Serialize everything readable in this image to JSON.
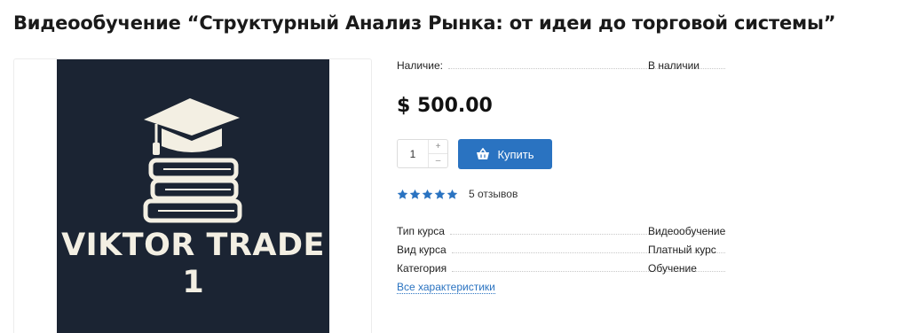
{
  "product": {
    "title": "Видеообучение “Структурный Анализ Рынка: от идеи до торговой системы”",
    "image": {
      "brand_line1": "VIKTOR TRADE",
      "brand_line2": "1",
      "background_color": "#1b2433",
      "foreground_color": "#f3efe3"
    },
    "availability": {
      "label": "Наличие:",
      "value": "В наличии"
    },
    "price": "$ 500.00",
    "quantity": "1",
    "qty_increase": "+",
    "qty_decrease": "–",
    "buy_label": "Купить",
    "buy_icon": "basket-icon",
    "rating": {
      "stars": 5,
      "max": 5,
      "reviews_text": "5 отзывов",
      "star_color": "#2a73c1"
    },
    "specs": [
      {
        "key": "Тип курса",
        "value": "Видеообучение"
      },
      {
        "key": "Вид курса",
        "value": "Платный курс"
      },
      {
        "key": "Категория",
        "value": "Обучение"
      }
    ],
    "all_specs_link": "Все характеристики"
  },
  "colors": {
    "accent": "#2a73c1",
    "text": "#222222"
  }
}
